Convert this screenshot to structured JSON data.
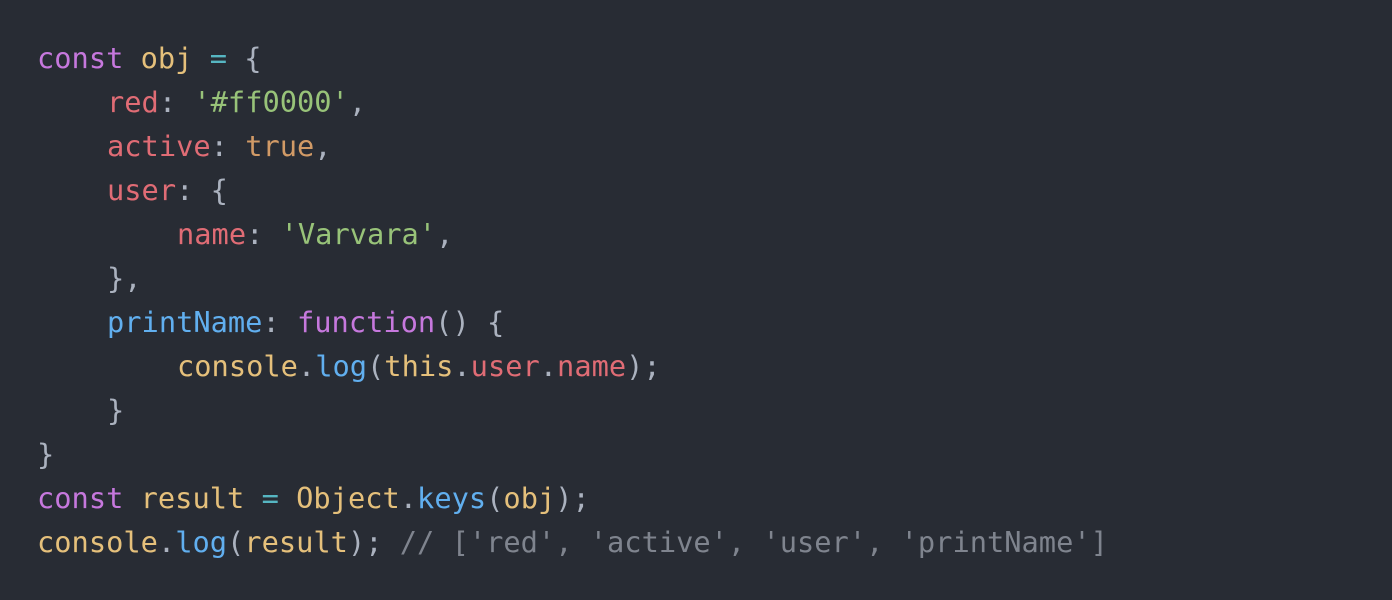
{
  "editor": {
    "theme_colors": {
      "background": "#282c34",
      "keyword": "#c678dd",
      "variable": "#e5c07b",
      "operator": "#56b6c2",
      "punctuation": "#abb2bf",
      "property": "#e06c75",
      "string": "#98c379",
      "boolean": "#d19a66",
      "function": "#61afef",
      "comment": "#7f848e"
    },
    "lines": [
      {
        "indent": 0,
        "tokens": [
          {
            "type": "kw",
            "text": "const"
          },
          {
            "type": "punc",
            "text": " "
          },
          {
            "type": "var",
            "text": "obj"
          },
          {
            "type": "punc",
            "text": " "
          },
          {
            "type": "op",
            "text": "="
          },
          {
            "type": "punc",
            "text": " {"
          }
        ]
      },
      {
        "indent": 1,
        "tokens": [
          {
            "type": "prop",
            "text": "red"
          },
          {
            "type": "punc",
            "text": ": "
          },
          {
            "type": "str",
            "text": "'#ff0000'"
          },
          {
            "type": "punc",
            "text": ","
          }
        ]
      },
      {
        "indent": 1,
        "tokens": [
          {
            "type": "prop",
            "text": "active"
          },
          {
            "type": "punc",
            "text": ": "
          },
          {
            "type": "bool",
            "text": "true"
          },
          {
            "type": "punc",
            "text": ","
          }
        ]
      },
      {
        "indent": 1,
        "tokens": [
          {
            "type": "prop",
            "text": "user"
          },
          {
            "type": "punc",
            "text": ": {"
          }
        ]
      },
      {
        "indent": 2,
        "tokens": [
          {
            "type": "prop",
            "text": "name"
          },
          {
            "type": "punc",
            "text": ": "
          },
          {
            "type": "str",
            "text": "'Varvara'"
          },
          {
            "type": "punc",
            "text": ","
          }
        ]
      },
      {
        "indent": 1,
        "tokens": [
          {
            "type": "punc",
            "text": "},"
          }
        ]
      },
      {
        "indent": 1,
        "tokens": [
          {
            "type": "fn",
            "text": "printName"
          },
          {
            "type": "punc",
            "text": ": "
          },
          {
            "type": "kw",
            "text": "function"
          },
          {
            "type": "punc",
            "text": "() {"
          }
        ]
      },
      {
        "indent": 2,
        "tokens": [
          {
            "type": "var",
            "text": "console"
          },
          {
            "type": "punc",
            "text": "."
          },
          {
            "type": "fn",
            "text": "log"
          },
          {
            "type": "punc",
            "text": "("
          },
          {
            "type": "var",
            "text": "this"
          },
          {
            "type": "punc",
            "text": "."
          },
          {
            "type": "prop",
            "text": "user"
          },
          {
            "type": "punc",
            "text": "."
          },
          {
            "type": "prop",
            "text": "name"
          },
          {
            "type": "punc",
            "text": ");"
          }
        ]
      },
      {
        "indent": 1,
        "tokens": [
          {
            "type": "punc",
            "text": "}"
          }
        ]
      },
      {
        "indent": 0,
        "tokens": [
          {
            "type": "punc",
            "text": "}"
          }
        ]
      },
      {
        "indent": 0,
        "tokens": [
          {
            "type": "kw",
            "text": "const"
          },
          {
            "type": "punc",
            "text": " "
          },
          {
            "type": "var",
            "text": "result"
          },
          {
            "type": "punc",
            "text": " "
          },
          {
            "type": "op",
            "text": "="
          },
          {
            "type": "punc",
            "text": " "
          },
          {
            "type": "cls",
            "text": "Object"
          },
          {
            "type": "punc",
            "text": "."
          },
          {
            "type": "fn",
            "text": "keys"
          },
          {
            "type": "punc",
            "text": "("
          },
          {
            "type": "var",
            "text": "obj"
          },
          {
            "type": "punc",
            "text": ");"
          }
        ]
      },
      {
        "indent": 0,
        "tokens": [
          {
            "type": "var",
            "text": "console"
          },
          {
            "type": "punc",
            "text": "."
          },
          {
            "type": "fn",
            "text": "log"
          },
          {
            "type": "punc",
            "text": "("
          },
          {
            "type": "var",
            "text": "result"
          },
          {
            "type": "punc",
            "text": "); "
          },
          {
            "type": "cmt",
            "text": "// ['red', 'active', 'user', 'printName']"
          }
        ]
      }
    ]
  }
}
